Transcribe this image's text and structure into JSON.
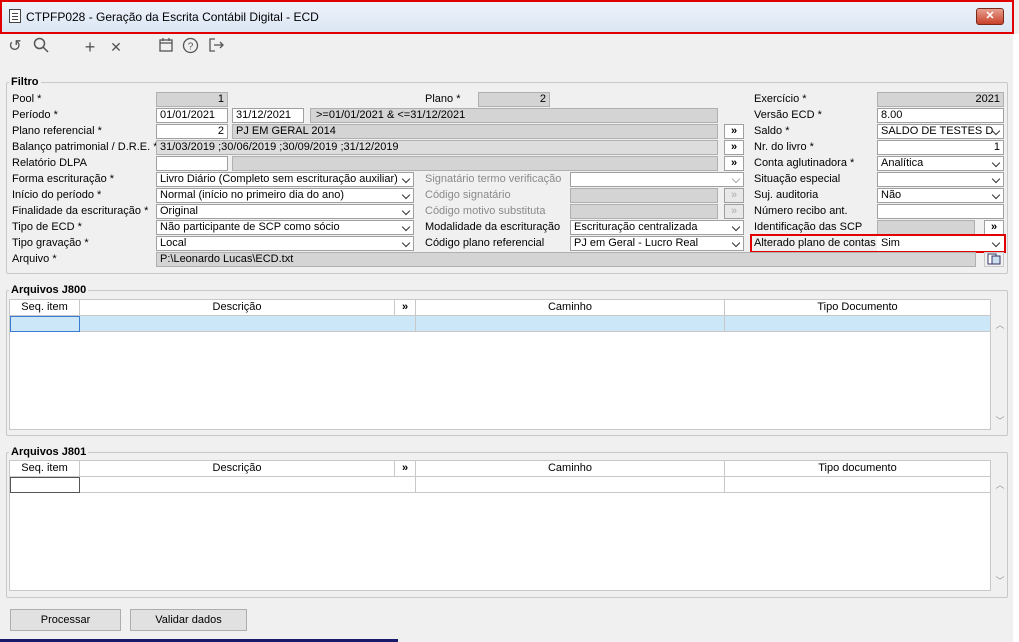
{
  "window": {
    "title": "CTPFP028 - Geração da Escrita Contábil Digital - ECD",
    "close": "✕"
  },
  "toolbar": {
    "undo": "↺",
    "search": "🔍",
    "add": "+",
    "delete": "✕",
    "calendar": "📅",
    "help": "?",
    "exit": "⇥"
  },
  "filtro": {
    "group_label": "Filtro",
    "pool_label": "Pool *",
    "pool": "1",
    "plano_label": "Plano *",
    "plano": "2",
    "exercicio_label": "Exercício *",
    "exercicio": "2021",
    "periodo_label": "Período *",
    "periodo_de": "01/01/2021",
    "periodo_ate": "31/12/2021",
    "periodo_expr": ">=01/01/2021 & <=31/12/2021",
    "versao_label": "Versão ECD *",
    "versao": "8.00",
    "plano_ref_label": "Plano referencial *",
    "plano_ref_code": "2",
    "plano_ref_desc": "PJ EM GERAL 2014",
    "saldo_label": "Saldo *",
    "saldo": "SALDO DE TESTES D",
    "balanco_label": "Balanço patrimonial / D.R.E. *",
    "balanco": "31/03/2019 ;30/06/2019 ;30/09/2019 ;31/12/2019",
    "nr_livro_label": "Nr. do livro *",
    "nr_livro": "1",
    "dlpa_label": "Relatório DLPA",
    "conta_aglut_label": "Conta aglutinadora *",
    "conta_aglut": "Analítica",
    "forma_label": "Forma escrituração *",
    "forma": "Livro Diário (Completo sem escrituração auxiliar)",
    "signatario_label": "Signatário termo verificação",
    "situacao_label": "Situação especial",
    "inicio_label": "Início do período *",
    "inicio": "Normal (início no primeiro dia do ano)",
    "cod_signatario_label": "Código signatário",
    "suj_auditoria_label": "Suj. auditoria",
    "suj_auditoria": "Não",
    "finalidade_label": "Finalidade da escrituração *",
    "finalidade": "Original",
    "cod_motivo_label": "Código motivo substituta",
    "nr_recibo_label": "Número recibo ant.",
    "tipo_ecd_label": "Tipo de ECD *",
    "tipo_ecd": "Não participante de SCP como sócio",
    "modalidade_label": "Modalidade da escrituração",
    "modalidade": "Escrituração centralizada",
    "ident_scp_label": "Identificação das SCP",
    "tipo_gravacao_label": "Tipo gravação *",
    "tipo_gravacao": "Local",
    "cod_plano_ref_label": "Código plano referencial",
    "cod_plano_ref": "PJ em Geral - Lucro Real",
    "alterado_label": "Alterado plano de contas",
    "alterado": "Sim",
    "arquivo_label": "Arquivo *",
    "arquivo": "P:\\Leonardo Lucas\\ECD.txt",
    "more": "»"
  },
  "j800": {
    "group_label": "Arquivos J800",
    "cols": [
      "Seq. item",
      "Descrição",
      "»",
      "Caminho",
      "Tipo Documento"
    ]
  },
  "j801": {
    "group_label": "Arquivos J801",
    "cols": [
      "Seq. item",
      "Descrição",
      "»",
      "Caminho",
      "Tipo documento"
    ]
  },
  "buttons": {
    "processar": "Processar",
    "validar": "Validar dados"
  },
  "colors": {
    "highlight": "#e00000",
    "selected_row": "#cce8f8"
  }
}
